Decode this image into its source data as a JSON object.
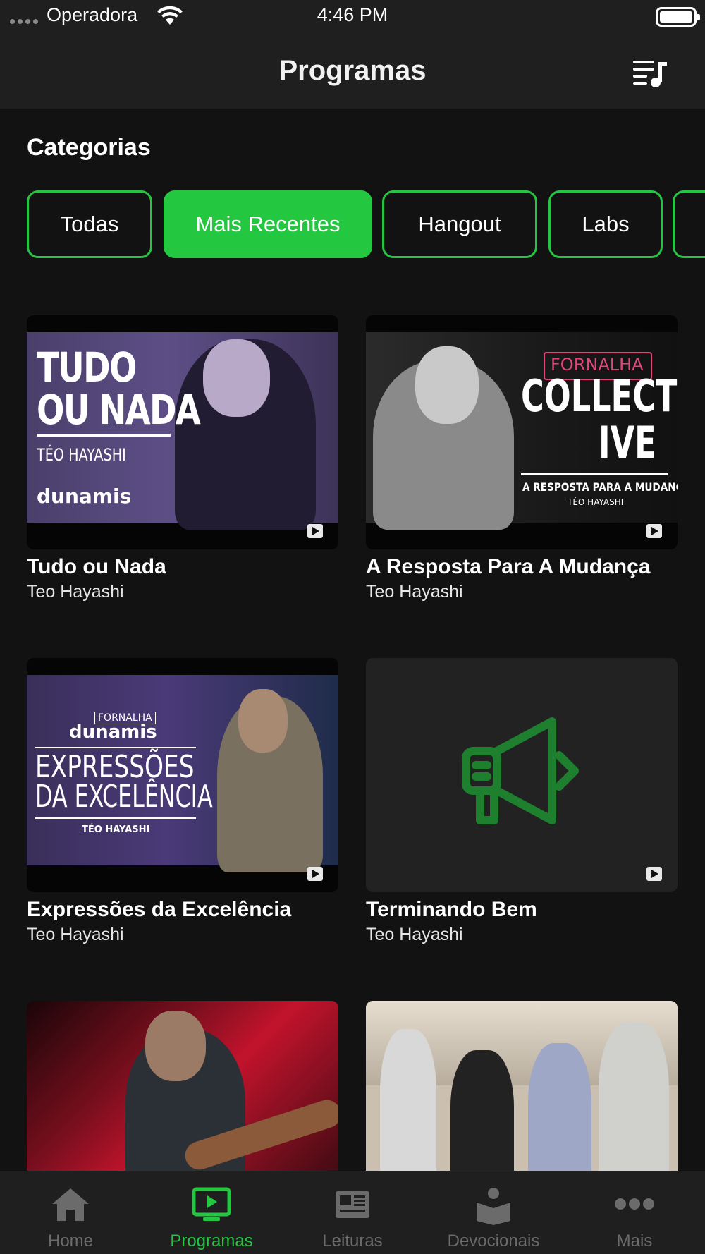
{
  "status_bar": {
    "carrier": "Operadora",
    "time": "4:46 PM"
  },
  "header": {
    "title": "Programas"
  },
  "categories": {
    "title": "Categorias",
    "chips": [
      {
        "label": "Todas",
        "active": false
      },
      {
        "label": "Mais Recentes",
        "active": true
      },
      {
        "label": "Hangout",
        "active": false
      },
      {
        "label": "Labs",
        "active": false
      },
      {
        "label": "",
        "active": false
      }
    ]
  },
  "programs": [
    {
      "title": "Tudo ou Nada",
      "author": "Teo Hayashi",
      "art_text": [
        "TUDO",
        "OU NADA",
        "TÉO HAYASHI",
        "dunamis"
      ]
    },
    {
      "title": "A Resposta Para A Mudança",
      "author": "Teo Hayashi",
      "art_text": [
        "FORNALHA",
        "COLLECT",
        "IVE",
        "A RESPOSTA PARA A MUDANÇA",
        "TÉO HAYASHI"
      ]
    },
    {
      "title": "Expressões da Excelência",
      "author": "Teo Hayashi",
      "art_text": [
        "FORNALHA",
        "dunamis",
        "EXPRESSÕES",
        "DA EXCELÊNCIA",
        "TÉO HAYASHI"
      ]
    },
    {
      "title": "Terminando Bem",
      "author": "Teo Hayashi",
      "icon": "megaphone-icon"
    },
    {
      "title": "",
      "author": ""
    },
    {
      "title": "",
      "author": ""
    }
  ],
  "tabs": [
    {
      "label": "Home",
      "icon": "home-icon",
      "active": false
    },
    {
      "label": "Programas",
      "icon": "tv-play-icon",
      "active": true
    },
    {
      "label": "Leituras",
      "icon": "newspaper-icon",
      "active": false
    },
    {
      "label": "Devocionais",
      "icon": "reading-person-icon",
      "active": false
    },
    {
      "label": "Mais",
      "icon": "more-dots-icon",
      "active": false
    }
  ],
  "colors": {
    "accent": "#23c840",
    "background": "#121212",
    "bar": "#1f1f1f",
    "inactive_tab": "#6b6b6b",
    "megaphone": "#1e7f2e"
  }
}
